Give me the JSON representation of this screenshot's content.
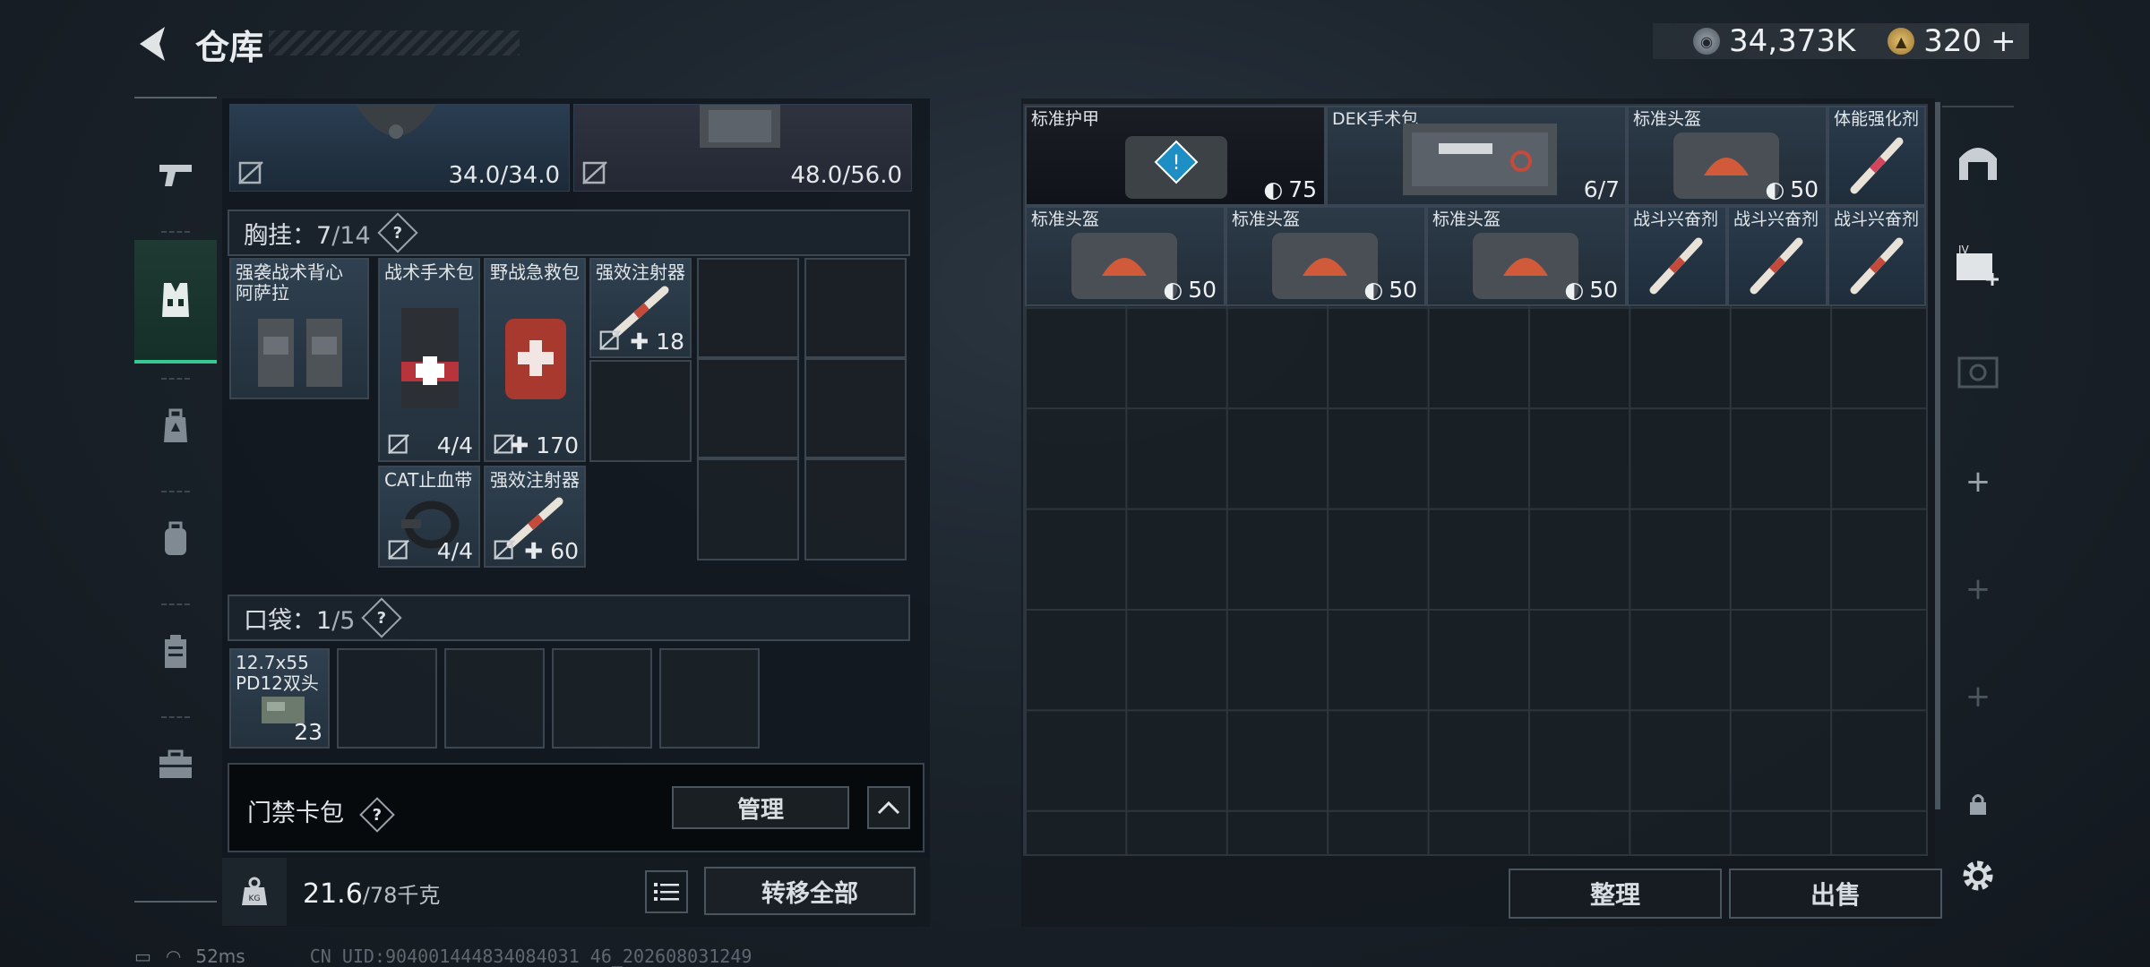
{
  "header": {
    "title": "仓库",
    "currency": [
      {
        "icon": "silver-coin-icon",
        "value": "34,373K"
      },
      {
        "icon": "gold-coin-icon",
        "value": "320"
      }
    ],
    "add_symbol": "+"
  },
  "left_nav": {
    "items": [
      {
        "icon": "gun-icon",
        "active": false
      },
      {
        "icon": "vest-icon",
        "active": true
      },
      {
        "icon": "bag-icon",
        "active": false
      },
      {
        "icon": "backpack-icon",
        "active": false
      },
      {
        "icon": "case-icon",
        "active": false
      },
      {
        "icon": "toolbox-icon",
        "active": false
      }
    ]
  },
  "gear": {
    "helmet_durability": "34.0/34.0",
    "armor_durability": "48.0/56.0"
  },
  "chest_rig": {
    "title": "胸挂：",
    "capacity_used": "7",
    "capacity_total": "/14",
    "help": "?",
    "vest": {
      "label": "强袭战术背心\n阿萨拉"
    },
    "items": [
      {
        "label": "战术手术包",
        "count": "4/4"
      },
      {
        "label": "野战急救包",
        "count": "170"
      },
      {
        "label": "强效注射器",
        "count": "18"
      },
      {
        "label": "CAT止血带",
        "count": "4/4"
      },
      {
        "label": "强效注射器",
        "count": "60"
      }
    ]
  },
  "pocket": {
    "title": "口袋：",
    "capacity_used": "1",
    "capacity_total": "/5",
    "help": "?",
    "items": [
      {
        "label": "12.7x55\nPD12双头",
        "count": "23"
      }
    ]
  },
  "keycard": {
    "label": "门禁卡包",
    "help": "?",
    "manage_label": "管理"
  },
  "weight": {
    "current": "21.6",
    "max": "/78千克",
    "icon_text": "KG"
  },
  "transfer_all_label": "转移全部",
  "stash": {
    "items": [
      {
        "label": "标准护甲",
        "value": "75",
        "kind": "armor"
      },
      {
        "label": "DEK手术包",
        "value": "6/7",
        "kind": "medkit"
      },
      {
        "label": "标准头盔",
        "value": "50",
        "kind": "helmet"
      },
      {
        "label": "体能强化剂",
        "value": "",
        "kind": "injector"
      },
      {
        "label": "标准头盔",
        "value": "50",
        "kind": "helmet"
      },
      {
        "label": "标准头盔",
        "value": "50",
        "kind": "helmet"
      },
      {
        "label": "标准头盔",
        "value": "50",
        "kind": "helmet"
      },
      {
        "label": "战斗兴奋剂",
        "value": "",
        "kind": "injector"
      },
      {
        "label": "战斗兴奋剂",
        "value": "",
        "kind": "injector"
      },
      {
        "label": "战斗兴奋剂",
        "value": "",
        "kind": "injector"
      }
    ],
    "sort_label": "整理",
    "sell_label": "出售"
  },
  "right_nav": {
    "items": [
      {
        "icon": "gate-icon"
      },
      {
        "icon": "add-card-icon",
        "badge": "IV"
      },
      {
        "icon": "ticket-icon"
      },
      {
        "icon": "plus-icon",
        "text": "+"
      },
      {
        "icon": "plus-icon",
        "text": "+"
      },
      {
        "icon": "plus-icon",
        "text": "+"
      },
      {
        "icon": "lock-icon"
      },
      {
        "icon": "gear-icon"
      }
    ]
  },
  "status": {
    "ping": "52ms",
    "uid": "CN UID:904001444834084031 46_202608031249"
  },
  "colors": {
    "accent": "#38c892",
    "panel": "#12181e",
    "slot_border": "#3b4650"
  }
}
